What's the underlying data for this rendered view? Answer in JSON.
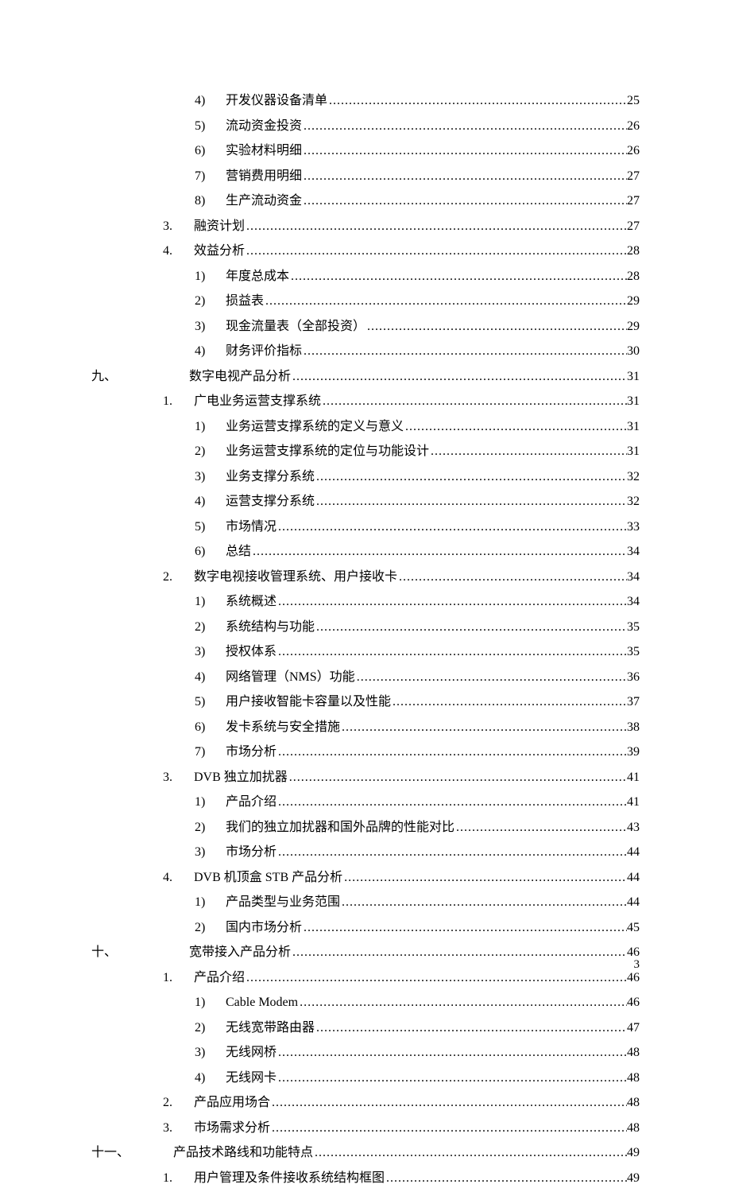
{
  "pageNumber": "3",
  "entries": [
    {
      "level": 2,
      "marker": "4)",
      "title": "开发仪器设备清单",
      "page": "25"
    },
    {
      "level": 2,
      "marker": "5)",
      "title": "流动资金投资",
      "page": "26"
    },
    {
      "level": 2,
      "marker": "6)",
      "title": "实验材料明细",
      "page": "26"
    },
    {
      "level": 2,
      "marker": "7)",
      "title": "营销费用明细",
      "page": "27"
    },
    {
      "level": 2,
      "marker": "8)",
      "title": "生产流动资金",
      "page": "27"
    },
    {
      "level": 1,
      "marker": "3.",
      "title": "融资计划",
      "page": "27"
    },
    {
      "level": 1,
      "marker": "4.",
      "title": "效益分析",
      "page": "28"
    },
    {
      "level": 2,
      "marker": "1)",
      "title": "年度总成本",
      "page": "28"
    },
    {
      "level": 2,
      "marker": "2)",
      "title": "损益表",
      "page": "29"
    },
    {
      "level": 2,
      "marker": "3)",
      "title": "现金流量表（全部投资）",
      "page": "29"
    },
    {
      "level": 2,
      "marker": "4)",
      "title": "财务评价指标",
      "page": "30"
    },
    {
      "level": 0,
      "marker": "九、",
      "title": "数字电视产品分析",
      "page": "31"
    },
    {
      "level": 1,
      "marker": "1.",
      "title": "广电业务运营支撑系统",
      "page": "31"
    },
    {
      "level": 2,
      "marker": "1)",
      "title": "业务运营支撑系统的定义与意义",
      "page": "31"
    },
    {
      "level": 2,
      "marker": "2)",
      "title": "业务运营支撑系统的定位与功能设计",
      "page": "31"
    },
    {
      "level": 2,
      "marker": "3)",
      "title": "业务支撑分系统",
      "page": "32"
    },
    {
      "level": 2,
      "marker": "4)",
      "title": "运营支撑分系统",
      "page": "32"
    },
    {
      "level": 2,
      "marker": "5)",
      "title": "市场情况",
      "page": "33"
    },
    {
      "level": 2,
      "marker": "6)",
      "title": "总结",
      "page": "34"
    },
    {
      "level": 1,
      "marker": "2.",
      "title": "数字电视接收管理系统、用户接收卡",
      "page": "34"
    },
    {
      "level": 2,
      "marker": "1)",
      "title": "系统概述",
      "page": "34"
    },
    {
      "level": 2,
      "marker": "2)",
      "title": "系统结构与功能",
      "page": "35"
    },
    {
      "level": 2,
      "marker": "3)",
      "title": "授权体系",
      "page": "35"
    },
    {
      "level": 2,
      "marker": "4)",
      "title": "网络管理（NMS）功能",
      "page": "36"
    },
    {
      "level": 2,
      "marker": "5)",
      "title": "用户接收智能卡容量以及性能",
      "page": "37"
    },
    {
      "level": 2,
      "marker": "6)",
      "title": "发卡系统与安全措施",
      "page": "38"
    },
    {
      "level": 2,
      "marker": "7)",
      "title": "市场分析",
      "page": "39"
    },
    {
      "level": 1,
      "marker": "3.",
      "title": "DVB 独立加扰器",
      "page": "41"
    },
    {
      "level": 2,
      "marker": "1)",
      "title": "产品介绍",
      "page": "41"
    },
    {
      "level": 2,
      "marker": "2)",
      "title": "我们的独立加扰器和国外品牌的性能对比",
      "page": "43"
    },
    {
      "level": 2,
      "marker": "3)",
      "title": "市场分析",
      "page": "44"
    },
    {
      "level": 1,
      "marker": "4.",
      "title": "DVB 机顶盒 STB 产品分析",
      "page": "44"
    },
    {
      "level": 2,
      "marker": "1)",
      "title": "产品类型与业务范围",
      "page": "44"
    },
    {
      "level": 2,
      "marker": "2)",
      "title": "国内市场分析",
      "page": "45"
    },
    {
      "level": 0,
      "marker": "十、",
      "title": "宽带接入产品分析",
      "page": "46"
    },
    {
      "level": 1,
      "marker": "1.",
      "title": "产品介绍",
      "page": "46"
    },
    {
      "level": 2,
      "marker": "1)",
      "title": "Cable Modem",
      "page": "46"
    },
    {
      "level": 2,
      "marker": "2)",
      "title": "无线宽带路由器",
      "page": "47"
    },
    {
      "level": 2,
      "marker": "3)",
      "title": "无线网桥",
      "page": "48"
    },
    {
      "level": 2,
      "marker": "4)",
      "title": "无线网卡",
      "page": "48"
    },
    {
      "level": 1,
      "marker": "2.",
      "title": "产品应用场合",
      "page": "48"
    },
    {
      "level": 1,
      "marker": "3.",
      "title": "市场需求分析",
      "page": "48"
    },
    {
      "level": 0,
      "marker": "十一、",
      "title": "产品技术路线和功能特点",
      "page": "49"
    },
    {
      "level": 1,
      "marker": "1.",
      "title": "用户管理及条件接收系统结构框图",
      "page": "49"
    }
  ]
}
